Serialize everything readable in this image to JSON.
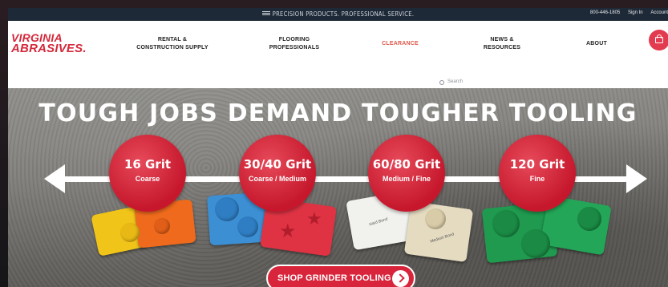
{
  "topbar": {
    "tagline": "PRECISION PRODUCTS. PROFESSIONAL SERVICE.",
    "phone": "800-446-1805",
    "sign_in": "Sign In",
    "account": "Account"
  },
  "header": {
    "logo_line1": "VIRGINIA",
    "logo_line2": "ABRASIVES.",
    "nav": [
      {
        "label_line1": "RENTAL &",
        "label_line2": "CONSTRUCTION SUPPLY"
      },
      {
        "label_line1": "FLOORING",
        "label_line2": "PROFESSIONALS"
      },
      {
        "label_line1": "CLEARANCE",
        "label_line2": ""
      },
      {
        "label_line1": "NEWS &",
        "label_line2": "RESOURCES"
      },
      {
        "label_line1": "ABOUT",
        "label_line2": ""
      }
    ],
    "search_placeholder": "Search",
    "accent": "#d4293b"
  },
  "hero": {
    "headline": "TOUGH JOBS DEMAND TOUGHER TOOLING",
    "grits": [
      {
        "grit": "16 Grit",
        "desc": "Coarse"
      },
      {
        "grit": "30/40 Grit",
        "desc": "Coarse / Medium"
      },
      {
        "grit": "60/80 Grit",
        "desc": "Medium / Fine"
      },
      {
        "grit": "120 Grit",
        "desc": "Fine"
      }
    ],
    "pad_labels": [
      "Hard Bond",
      "Medium Bond"
    ],
    "cta": "SHOP GRINDER TOOLING",
    "cta_color": "#d8253b"
  }
}
